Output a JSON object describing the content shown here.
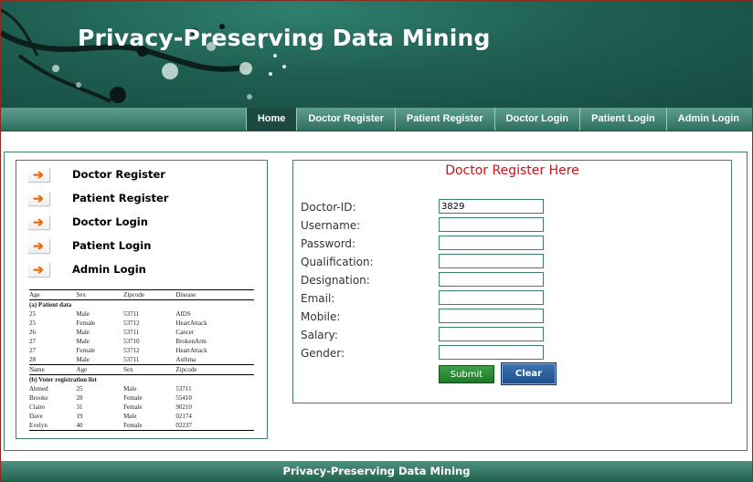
{
  "site": {
    "title": "Privacy-Preserving Data Mining"
  },
  "nav": [
    {
      "label": "Home",
      "active": true
    },
    {
      "label": "Doctor Register"
    },
    {
      "label": "Patient Register"
    },
    {
      "label": "Doctor Login"
    },
    {
      "label": "Patient Login"
    },
    {
      "label": "Admin Login"
    }
  ],
  "sidebar": {
    "items": [
      {
        "label": "Doctor Register"
      },
      {
        "label": "Patient Register"
      },
      {
        "label": "Doctor Login"
      },
      {
        "label": "Patient Login"
      },
      {
        "label": "Admin Login"
      }
    ],
    "table": {
      "header1": [
        "Age",
        "Sex",
        "Zipcode",
        "Disease"
      ],
      "caption1": "(a) Patient data",
      "rows1": [
        [
          "25",
          "Male",
          "53711",
          "AIDS"
        ],
        [
          "25",
          "Female",
          "53712",
          "HeartAttack"
        ],
        [
          "26",
          "Male",
          "53711",
          "Cancer"
        ],
        [
          "27",
          "Male",
          "53710",
          "BrokenArm"
        ],
        [
          "27",
          "Female",
          "53712",
          "HeartAttack"
        ],
        [
          "28",
          "Male",
          "53711",
          "Asthma"
        ]
      ],
      "header2": [
        "Name",
        "Age",
        "Sex",
        "Zipcode"
      ],
      "caption2": "(b) Voter registration list",
      "rows2": [
        [
          "Ahmed",
          "25",
          "Male",
          "53711"
        ],
        [
          "Brooke",
          "28",
          "Female",
          "55410"
        ],
        [
          "Claire",
          "31",
          "Female",
          "90210"
        ],
        [
          "Dave",
          "19",
          "Male",
          "02174"
        ],
        [
          "Evelyn",
          "40",
          "Female",
          "02237"
        ]
      ]
    }
  },
  "form": {
    "title": "Doctor Register Here",
    "fields": [
      {
        "label": "Doctor-ID:",
        "value": "3829"
      },
      {
        "label": "Username:",
        "value": ""
      },
      {
        "label": "Password:",
        "value": ""
      },
      {
        "label": "Qualification:",
        "value": ""
      },
      {
        "label": "Designation:",
        "value": ""
      },
      {
        "label": "Email:",
        "value": ""
      },
      {
        "label": "Mobile:",
        "value": ""
      },
      {
        "label": "Salary:",
        "value": ""
      },
      {
        "label": "Gender:",
        "value": ""
      }
    ],
    "submit_label": "Submit",
    "clear_label": "Clear"
  },
  "footer": {
    "text": "Privacy-Preserving Data Mining"
  },
  "colors": {
    "brand": "#1f5f52",
    "title_red": "#c8141a",
    "submit_green": "#2a8c34",
    "clear_blue": "#2a5e9e",
    "arrow_orange": "#ea6a12"
  }
}
